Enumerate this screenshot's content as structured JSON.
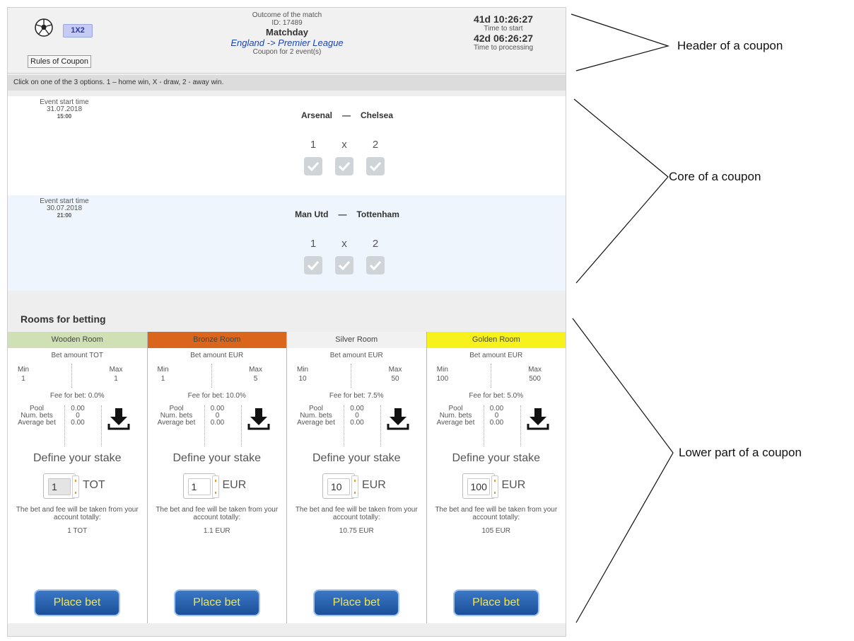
{
  "header": {
    "market_badge": "1X2",
    "rules_button": "Rules of Coupon",
    "outcome_label": "Outcome of the match",
    "id_label": "ID: 17489",
    "coupon_type": "Matchday",
    "league": "England -> Premier League",
    "coupon_for": "Coupon for 2 event(s)",
    "time_to_start": "41d 10:26:27",
    "time_to_start_label": "Time to start",
    "time_to_processing": "42d 06:26:27",
    "time_to_processing_label": "Time to processing"
  },
  "instructions": "Click on one of the 3 options. 1 – home win, X - draw, 2 - away win.",
  "events": [
    {
      "start_label": "Event start time",
      "date": "31.07.2018",
      "hour": "15:00",
      "home": "Arsenal",
      "dash": "—",
      "away": "Chelsea",
      "opt1": "1",
      "optx": "x",
      "opt2": "2"
    },
    {
      "start_label": "Event start time",
      "date": "30.07.2018",
      "hour": "21:00",
      "home": "Man Utd",
      "dash": "—",
      "away": "Tottenham",
      "opt1": "1",
      "optx": "x",
      "opt2": "2"
    }
  ],
  "rooms_title": "Rooms for betting",
  "rooms": [
    {
      "name": "Wooden Room",
      "color": "#cfe0b4",
      "bet_amount": "Bet amount TOT",
      "min_label": "Min",
      "min": "1",
      "max_label": "Max",
      "max": "1",
      "fee": "Fee for bet: 0.0%",
      "pool_label": "Pool",
      "pool": "0.00",
      "numbets_label": "Num. bets",
      "numbets": "0",
      "avg_label": "Average bet",
      "avg": "0.00",
      "define": "Define your stake",
      "stake": "1",
      "currency": "TOT",
      "note": "The bet and fee will be taken from your account totally:",
      "total": "1 TOT",
      "place": "Place bet"
    },
    {
      "name": "Bronze Room",
      "color": "#d9661c",
      "bet_amount": "Bet amount EUR",
      "min_label": "Min",
      "min": "1",
      "max_label": "Max",
      "max": "5",
      "fee": "Fee for bet: 10.0%",
      "pool_label": "Pool",
      "pool": "0.00",
      "numbets_label": "Num. bets",
      "numbets": "0",
      "avg_label": "Average bet",
      "avg": "0.00",
      "define": "Define your stake",
      "stake": "1",
      "currency": "EUR",
      "note": "The bet and fee will be taken from your account totally:",
      "total": "1.1 EUR",
      "place": "Place bet"
    },
    {
      "name": "Silver Room",
      "color": "#f1f1f1",
      "bet_amount": "Bet amount EUR",
      "min_label": "Min",
      "min": "10",
      "max_label": "Max",
      "max": "50",
      "fee": "Fee for bet: 7.5%",
      "pool_label": "Pool",
      "pool": "0.00",
      "numbets_label": "Num. bets",
      "numbets": "0",
      "avg_label": "Average bet",
      "avg": "0.00",
      "define": "Define your stake",
      "stake": "10",
      "currency": "EUR",
      "note": "The bet and fee will be taken from your account totally:",
      "total": "10.75 EUR",
      "place": "Place bet"
    },
    {
      "name": "Golden Room",
      "color": "#f7f21b",
      "bet_amount": "Bet amount EUR",
      "min_label": "Min",
      "min": "100",
      "max_label": "Max",
      "max": "500",
      "fee": "Fee for bet: 5.0%",
      "pool_label": "Pool",
      "pool": "0.00",
      "numbets_label": "Num. bets",
      "numbets": "0",
      "avg_label": "Average bet",
      "avg": "0.00",
      "define": "Define your stake",
      "stake": "100",
      "currency": "EUR",
      "note": "The bet and fee will be taken from your account totally:",
      "total": "105 EUR",
      "place": "Place bet"
    }
  ],
  "annotations": {
    "header": "Header of a coupon",
    "core": "Core of a coupon",
    "lower": "Lower part of a coupon"
  }
}
